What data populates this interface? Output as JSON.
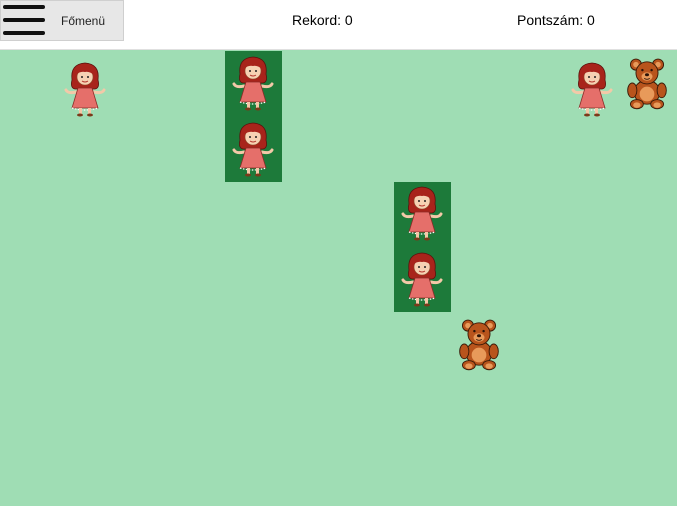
{
  "header": {
    "menu_label": "Főmenü",
    "record_label": "Rekord: 0",
    "score_label": "Pontszám: 0"
  },
  "icons": {
    "menu": "hamburger-icon",
    "doll": "doll-icon",
    "bear": "teddy-bear-icon"
  },
  "colors": {
    "board": "#9fddb4",
    "column": "#1d7a3a"
  }
}
